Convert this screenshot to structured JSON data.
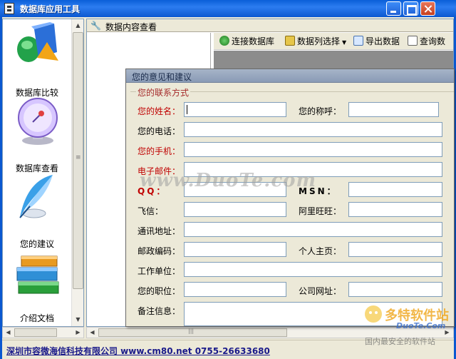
{
  "window": {
    "title": "数据库应用工具"
  },
  "sidebar": {
    "items": [
      {
        "label": "数据库比较",
        "icon": "database-compare-icon"
      },
      {
        "label": "数据库查看",
        "icon": "database-view-icon"
      },
      {
        "label": "您的建议",
        "icon": "feather-pen-icon"
      },
      {
        "label": "介绍文档",
        "icon": "books-icon"
      }
    ]
  },
  "panel": {
    "title": "数据内容查看"
  },
  "toolbar": {
    "connect": "连接数据库",
    "columns": "数据列选择",
    "export": "导出数据",
    "query": "查询数"
  },
  "dialog": {
    "title": "您的意见和建议",
    "group": "您的联系方式",
    "fields": {
      "name": "您的姓名：",
      "title": "您的称呼：",
      "phone": "您的电话：",
      "mobile": "您的手机：",
      "email": "电子邮件：",
      "qq": "QQ：",
      "msn": "MSN：",
      "fetion": "飞信：",
      "wangwang": "阿里旺旺：",
      "address": "通讯地址：",
      "postcode": "邮政编码：",
      "homepage": "个人主页：",
      "company": "工作单位：",
      "position": "您的职位：",
      "companyweb": "公司网址：",
      "remarks": "备注信息："
    }
  },
  "statusbar": {
    "company": "深圳市容微海信科技有限公司 www.cm80.net 0755-26633680"
  },
  "watermark": "www.DuoTe.com",
  "logo": {
    "brand": "多特软件站",
    "url": "DuoTe.Com",
    "slogan": "国内最安全的软件站"
  },
  "colors": {
    "required": "#c00000",
    "titlebar": "#0b58d0",
    "dialog_title": "#8a9bb6"
  }
}
